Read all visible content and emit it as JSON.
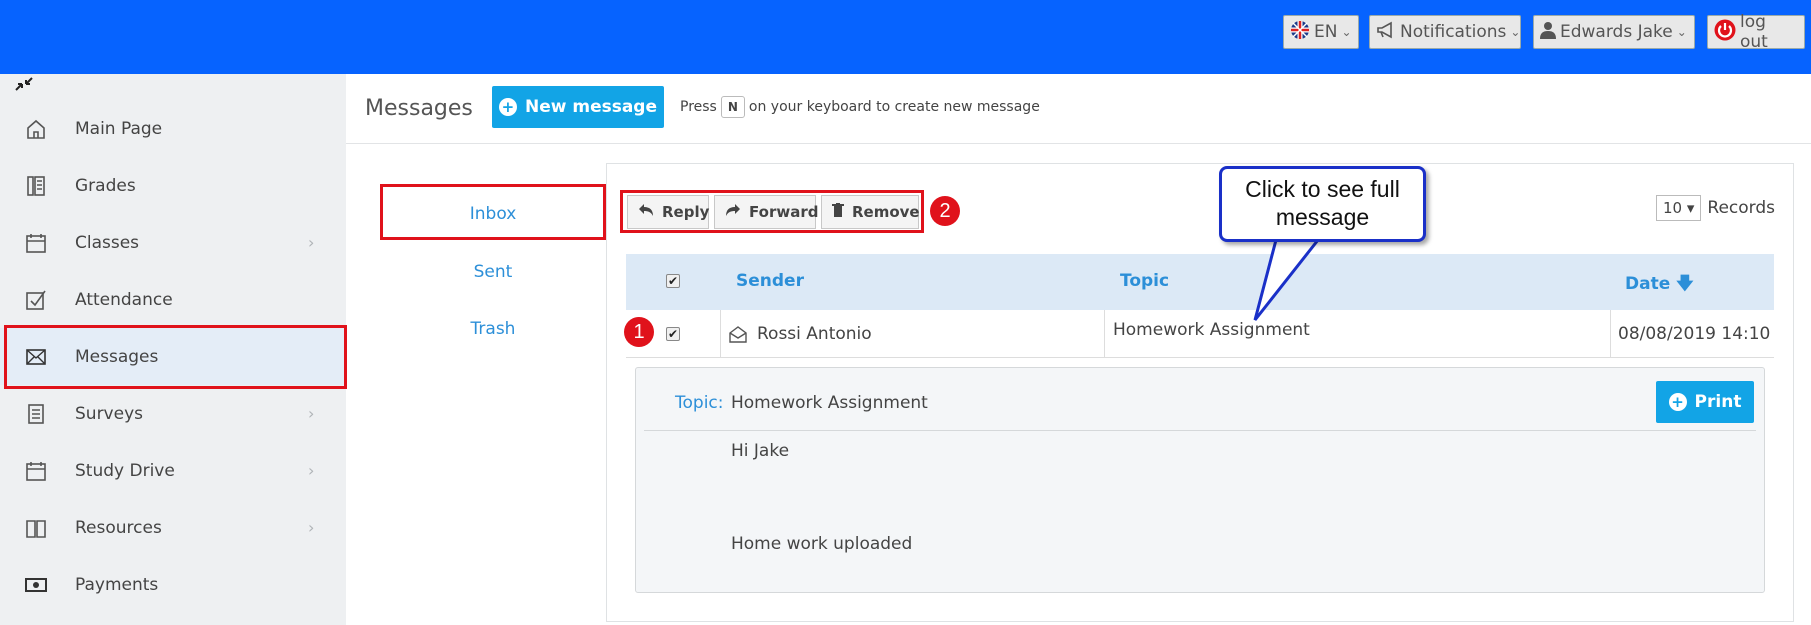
{
  "topbar": {
    "lang": "EN",
    "notifications": "Notifications",
    "user": "Edwards Jake",
    "logout": "log out"
  },
  "sidebar": {
    "items": [
      {
        "label": "Main Page",
        "icon": "home-icon",
        "submenu": false
      },
      {
        "label": "Grades",
        "icon": "grades-icon",
        "submenu": false
      },
      {
        "label": "Classes",
        "icon": "calendar-icon",
        "submenu": true
      },
      {
        "label": "Attendance",
        "icon": "checkbox-icon",
        "submenu": false
      },
      {
        "label": "Messages",
        "icon": "envelope-icon",
        "submenu": false,
        "active": true
      },
      {
        "label": "Surveys",
        "icon": "survey-icon",
        "submenu": true
      },
      {
        "label": "Study Drive",
        "icon": "calendar-icon",
        "submenu": true
      },
      {
        "label": "Resources",
        "icon": "book-icon",
        "submenu": true
      },
      {
        "label": "Payments",
        "icon": "money-icon",
        "submenu": false
      }
    ]
  },
  "header": {
    "title": "Messages",
    "new_message": "New message",
    "hint_before": "Press",
    "hint_key": "N",
    "hint_after": "on your keyboard to create new message"
  },
  "folders": [
    "Inbox",
    "Sent",
    "Trash"
  ],
  "toolbar": {
    "reply": "Reply",
    "forward": "Forward",
    "remove": "Remove",
    "records_value": "10",
    "records_label": "Records"
  },
  "annotations": {
    "badge1": "1",
    "badge2": "2",
    "callout_line1": "Click to see full",
    "callout_line2": "message"
  },
  "table": {
    "headers": {
      "sender": "Sender",
      "topic": "Topic",
      "date": "Date"
    },
    "rows": [
      {
        "sender": "Rossi Antonio",
        "topic": "Homework Assignment",
        "date": "08/08/2019 14:10",
        "checked": true
      }
    ]
  },
  "detail": {
    "topic_label": "Topic:",
    "topic_value": "Homework Assignment",
    "print": "Print",
    "greeting": "Hi Jake",
    "body": "Home work uploaded"
  },
  "colors": {
    "topbar": "#0663ff",
    "accent": "#12a4e6",
    "link": "#2c8fd8",
    "highlight_border": "#e0121b",
    "callout_border": "#1a30c8"
  }
}
